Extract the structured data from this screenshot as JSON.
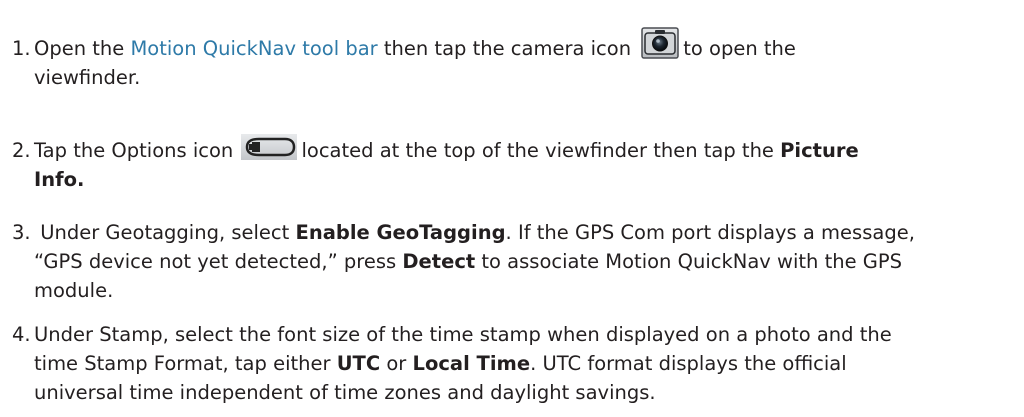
{
  "steps": [
    {
      "number": "1.",
      "pre_link": "Open the ",
      "link": "Motion QuickNav tool bar",
      "post_link": " then tap the camera icon",
      "icon": "camera-icon",
      "after_icon": "to open the",
      "line2": "viewfinder."
    },
    {
      "number": "2.",
      "pre_icon": "Tap the Options icon",
      "icon": "options-icon",
      "after_icon": "located at the top of the viewfinder then tap the ",
      "bold": "Picture",
      "line2_bold": "Info."
    },
    {
      "number": "3.",
      "text_a": " Under Geotagging, select ",
      "bold_a": "Enable GeoTagging",
      "text_b": ". If the GPS Com port displays a message,",
      "line2_a": "“GPS device not yet detected,” press ",
      "bold_b": "Detect",
      "line2_b": " to associate Motion QuickNav with the GPS",
      "line3": "module."
    },
    {
      "number": "4.",
      "line1": "Under Stamp, select the font size of the time stamp when displayed on a photo and the",
      "line2_a": "time Stamp Format, tap either ",
      "bold_a": "UTC",
      "line2_b": " or ",
      "bold_b": "Local Time",
      "line2_c": ". UTC format displays the official",
      "line3": "universal time independent of time zones and daylight savings."
    }
  ],
  "colors": {
    "text": "#231f20",
    "link": "#2e7aa8"
  }
}
